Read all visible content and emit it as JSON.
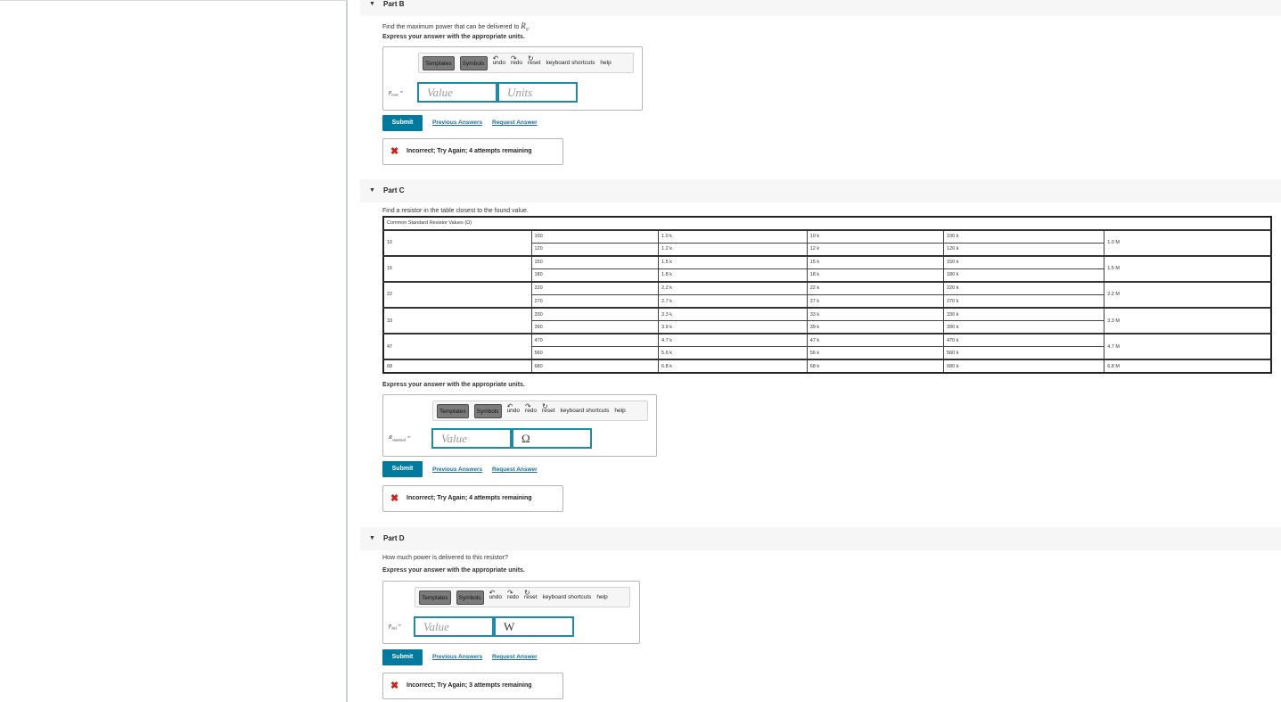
{
  "partB": {
    "header": "Part B",
    "question_prefix": "Find the maximum power that can be delivered to ",
    "question_var": "R",
    "question_sub": "o",
    "question_suffix": ".",
    "instruction": "Express your answer with the appropriate units.",
    "toolbar": {
      "templates": "Templates",
      "symbols": "Symbols",
      "undo": "undo",
      "redo": "redo",
      "reset": "reset",
      "shortcuts": "keyboard shortcuts",
      "help": "help"
    },
    "var_main": "p",
    "var_sub": "max",
    "equals": "=",
    "value_placeholder": "Value",
    "units_placeholder": "Units",
    "submit": "Submit",
    "previous_answers": "Previous Answers",
    "request_answer": "Request Answer",
    "feedback": "Incorrect; Try Again; 4 attempts remaining"
  },
  "partC": {
    "header": "Part C",
    "question": "Find a resistor in the table closest to the found value.",
    "table_caption": "Common Standard Resistor Values (Ω)",
    "table_groups": [
      {
        "col1": "10",
        "rows": [
          [
            "100",
            "1.0 k",
            "10 k",
            "100 k"
          ],
          [
            "120",
            "1.2 k",
            "12 k",
            "120 k"
          ]
        ],
        "col6": "1.0 M"
      },
      {
        "col1": "15",
        "rows": [
          [
            "150",
            "1.5 k",
            "15 k",
            "150 k"
          ],
          [
            "180",
            "1.8 k",
            "18 k",
            "180 k"
          ]
        ],
        "col6": "1.5 M"
      },
      {
        "col1": "22",
        "rows": [
          [
            "220",
            "2.2 k",
            "22 k",
            "220 k"
          ],
          [
            "270",
            "2.7 k",
            "27 k",
            "270 k"
          ]
        ],
        "col6": "2.2 M"
      },
      {
        "col1": "33",
        "rows": [
          [
            "330",
            "3.3 k",
            "33 k",
            "330 k"
          ],
          [
            "390",
            "3.9 k",
            "39 k",
            "390 k"
          ]
        ],
        "col6": "3.3 M"
      },
      {
        "col1": "47",
        "rows": [
          [
            "470",
            "4.7 k",
            "47 k",
            "470 k"
          ],
          [
            "560",
            "5.6 k",
            "56 k",
            "560 k"
          ]
        ],
        "col6": "4.7 M"
      },
      {
        "col1": "68",
        "rows": [
          [
            "680",
            "6.8 k",
            "68 k",
            "680 k"
          ]
        ],
        "col6": "6.8 M"
      }
    ],
    "instruction": "Express your answer with the appropriate units.",
    "toolbar": {
      "templates": "Templates",
      "symbols": "Symbols",
      "undo": "undo",
      "redo": "redo",
      "reset": "reset",
      "shortcuts": "keyboard shortcuts",
      "help": "help"
    },
    "var_main": "R",
    "var_sub": "standard",
    "equals": "=",
    "value_placeholder": "Value",
    "unit_value": "Ω",
    "submit": "Submit",
    "previous_answers": "Previous Answers",
    "request_answer": "Request Answer",
    "feedback": "Incorrect; Try Again; 4 attempts remaining"
  },
  "partD": {
    "header": "Part D",
    "question": "How much power is delivered to this resistor?",
    "instruction": "Express your answer with the appropriate units.",
    "toolbar": {
      "templates": "Templates",
      "symbols": "Symbols",
      "undo": "undo",
      "redo": "redo",
      "reset": "reset",
      "shortcuts": "keyboard shortcuts",
      "help": "help"
    },
    "var_main": "p",
    "var_sub": "del",
    "equals": "=",
    "value_placeholder": "Value",
    "unit_value": "W",
    "submit": "Submit",
    "previous_answers": "Previous Answers",
    "request_answer": "Request Answer",
    "feedback": "Incorrect; Try Again; 3 attempts remaining"
  },
  "colors": {
    "accent": "#017aa0",
    "field_border": "#1f8aa7",
    "error": "#d0201c",
    "link": "#1a6e9a"
  }
}
